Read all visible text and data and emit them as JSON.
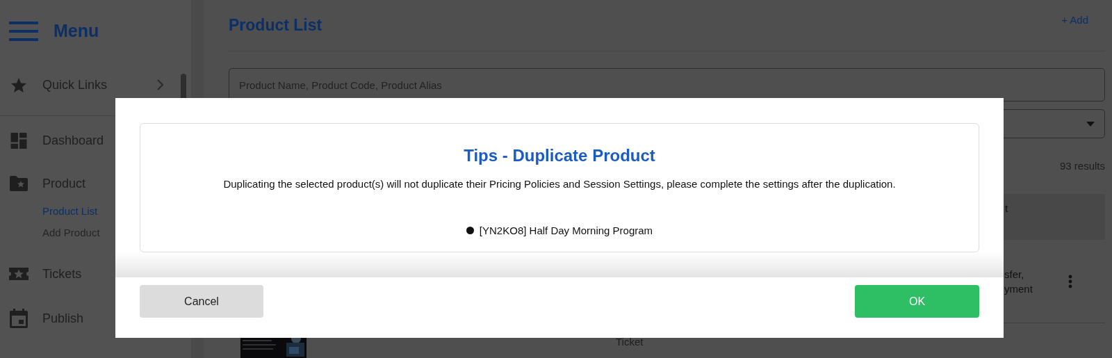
{
  "sidebar": {
    "title": "Menu",
    "items": [
      {
        "kind": "link",
        "label": "Quick Links",
        "expandable": true
      },
      {
        "kind": "link",
        "label": "Dashboard"
      },
      {
        "kind": "link",
        "label": "Product",
        "children": [
          {
            "label": "Product List",
            "selected": true
          },
          {
            "label": "Add Product",
            "selected": false
          }
        ]
      },
      {
        "kind": "link",
        "label": "Tickets"
      },
      {
        "kind": "link",
        "label": "Publish"
      }
    ]
  },
  "page": {
    "title": "Product List",
    "add_button": "+ Add",
    "search": {
      "placeholder": "Product Name, Product Code, Product Alias"
    },
    "results": "93 results",
    "table": {
      "header": "t",
      "rows": [
        {
          "kind": "text",
          "lines": [
            "sfer,",
            "yment"
          ],
          "menu": true
        },
        {
          "kind": "picture",
          "type": "Ticket"
        }
      ]
    }
  },
  "dialog": {
    "title": "Tips - Duplicate Product",
    "message": "Duplicating the selected product(s) will not duplicate their Pricing Policies and Session Settings, please complete the settings after the duplication.",
    "items": [
      "[YN2KO8] Half Day Morning Program"
    ],
    "buttons": [
      {
        "kind": "secondary",
        "label": "Cancel"
      },
      {
        "kind": "primary",
        "label": "OK"
      }
    ]
  }
}
